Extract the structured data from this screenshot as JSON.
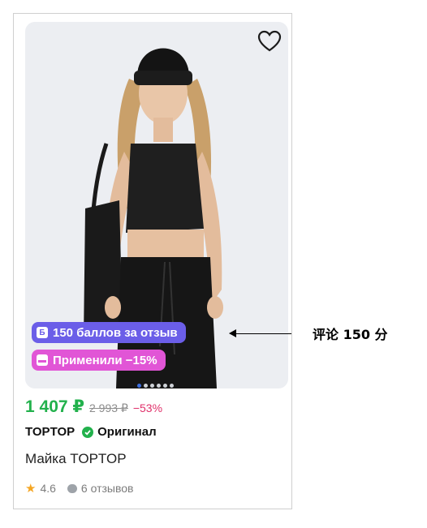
{
  "product": {
    "price_current": "1 407 ₽",
    "price_old": "2 993 ₽",
    "discount": "−53%",
    "brand": "TOPTOP",
    "original_label": "Оригинал",
    "title": "Майка TOPTOP",
    "rating": "4.6",
    "reviews": "6 отзывов",
    "images_count": 6,
    "active_image": 1
  },
  "badges": {
    "bonus": "150 баллов за отзыв",
    "discount_applied": "Применили −15%"
  },
  "annotation": {
    "text": "评论 150 分"
  },
  "colors": {
    "price_green": "#22b14c",
    "discount_pink": "#e0306a",
    "bonus_badge": "#6b5ee8",
    "discount_badge": "#e155d6",
    "star": "#f5a623"
  },
  "icons": {
    "favorite": "heart-icon",
    "bonus": "b-coin-icon",
    "discount": "card-icon",
    "original": "check-circle-icon",
    "rating": "star-icon",
    "reviews": "comment-icon"
  }
}
